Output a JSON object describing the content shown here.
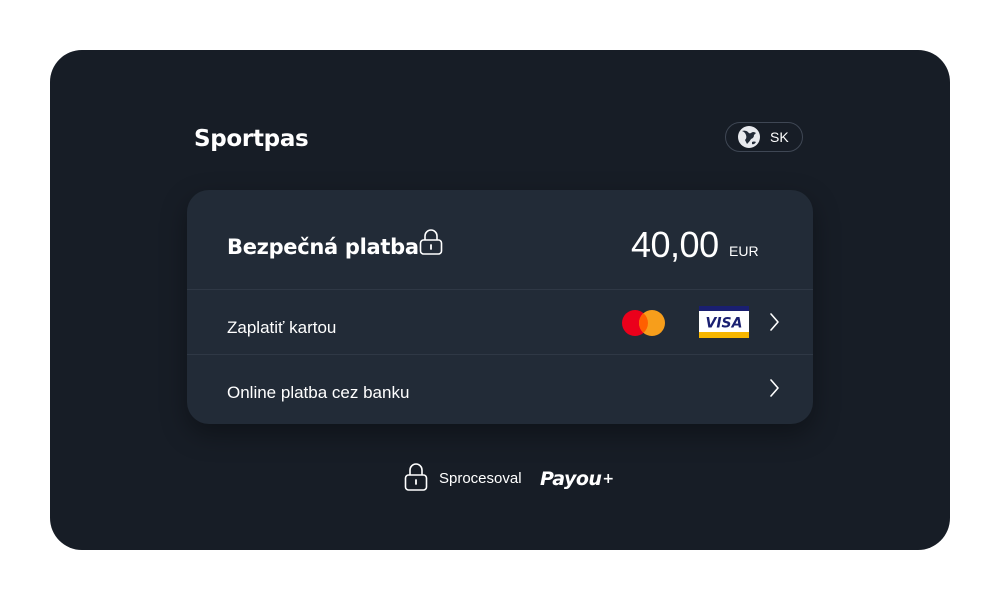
{
  "header": {
    "merchant_name": "Sportpas",
    "language": {
      "code": "SK",
      "icon": "globe-icon"
    }
  },
  "payment": {
    "title": "Bezpečná platba",
    "title_icon": "lock-icon",
    "amount": "40,00",
    "currency": "EUR",
    "methods": [
      {
        "label": "Zaplatiť kartou",
        "brands": [
          "Mastercard",
          "VISA"
        ],
        "icon": "chevron-right-icon"
      },
      {
        "label": "Online platba cez banku",
        "icon": "chevron-right-icon"
      }
    ]
  },
  "footer": {
    "processed_by": "Sprocesoval",
    "processor_logo": "Payou",
    "processor_logo_suffix": "+",
    "icon": "lock-icon"
  },
  "colors": {
    "page_background": "#ffffff",
    "window_background": "#171d26",
    "card_background": "#222b37",
    "mastercard_red": "#eb001b",
    "mastercard_orange": "#f79e1b",
    "visa_blue": "#1a1f71",
    "visa_gold": "#f7b600"
  }
}
